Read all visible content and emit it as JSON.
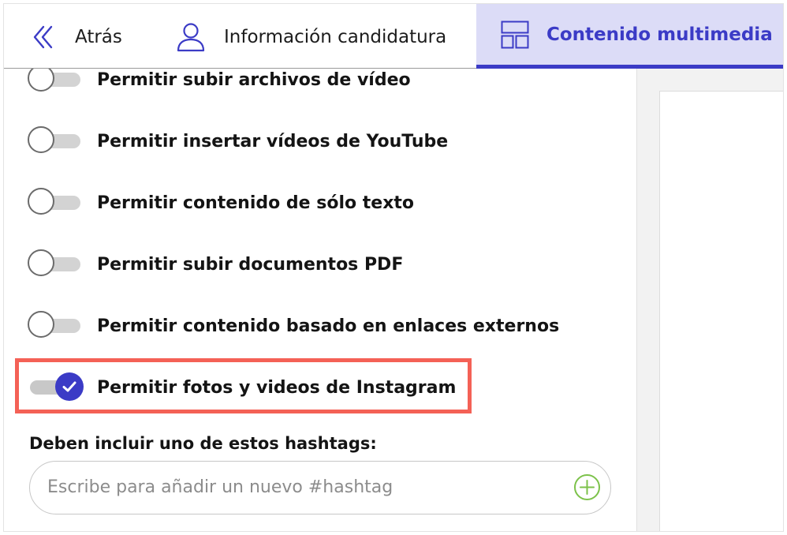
{
  "nav": {
    "back_label": "Atrás",
    "info_label": "Información candidatura",
    "media_label": "Contenido multimedia"
  },
  "options": [
    {
      "label": "Permitir subir archivos de vídeo",
      "enabled": false
    },
    {
      "label": "Permitir insertar vídeos de YouTube",
      "enabled": false
    },
    {
      "label": "Permitir contenido de sólo texto",
      "enabled": false
    },
    {
      "label": "Permitir subir documentos PDF",
      "enabled": false
    },
    {
      "label": "Permitir contenido basado en enlaces externos",
      "enabled": false
    },
    {
      "label": "Permitir fotos y videos de Instagram",
      "enabled": true
    }
  ],
  "hashtags": {
    "label": "Deben incluir uno de estos hashtags:",
    "placeholder": "Escribe para añadir un nuevo #hashtag"
  },
  "colors": {
    "accent": "#3b3bc6",
    "active_tab_bg": "#dcdcf7",
    "highlight": "#f46156",
    "add_icon": "#7cc24a"
  },
  "icons": {
    "back": "double-chevron-left-icon",
    "info": "user-icon",
    "media": "layout-grid-icon",
    "check": "check-icon",
    "add": "plus-circle-icon"
  }
}
